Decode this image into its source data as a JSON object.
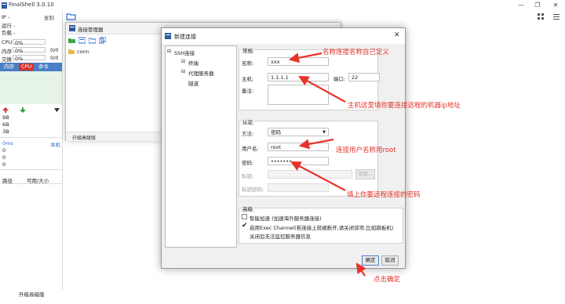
{
  "app": {
    "title": "FinalShell 3.0.10",
    "copy_label": "复制",
    "ip_label": "IP -",
    "uptime_label": "运行 -",
    "load_label": "负载 -",
    "cpu_label": "CPU",
    "cpu_value": "0%",
    "mem_label": "内存",
    "mem_value": "0%",
    "mem_ratio": "0/0",
    "swap_label": "交换",
    "swap_value": "0%",
    "swap_ratio": "0/0",
    "proc_tabs": [
      "内存",
      "CPU",
      "命令"
    ],
    "net_scale": [
      "9B",
      "6B",
      "3B"
    ],
    "latency_label": "0ms",
    "host_label": "本机",
    "latency_values": [
      "0",
      "0",
      "0"
    ],
    "disk_path_label": "路径",
    "disk_size_label": "可用/大小",
    "upgrade_label": "升级高级版"
  },
  "conn_mgr": {
    "title": "连接管理器",
    "items": [
      "conn"
    ],
    "upgrade_label": "升级高级版"
  },
  "dialog": {
    "title": "新建连接",
    "tree": {
      "root": "SSH连接",
      "children": [
        "终端",
        "代理服务器",
        "隧道"
      ]
    },
    "general": {
      "group_label": "常规",
      "name_label": "名称:",
      "name_value": "xxx",
      "host_label": "主机:",
      "host_value": "1.1.1.1",
      "port_label": "端口:",
      "port_value": "22",
      "remark_label": "备注:"
    },
    "auth": {
      "group_label": "认证",
      "method_label": "方法:",
      "method_value": "密码",
      "user_label": "用户名:",
      "user_value": "root",
      "pass_label": "密码:",
      "pass_value": "•••••••",
      "key_label": "私钥:",
      "browse_label": "浏览...",
      "keypass_label": "私钥密码:"
    },
    "advanced": {
      "group_label": "高级",
      "smart_accel": "智能加速 (加速海外服务器连接)",
      "exec_channel": "启用Exec Channel(若连接上就被断开,请关闭该项,比如跳板机)",
      "exec_note": "关闭后无法监控服务器信息"
    },
    "ok_label": "确定",
    "cancel_label": "取消"
  },
  "annotations": {
    "name": "名称连接名称自己定义",
    "host": "主机这里填你要连接远程的机器ip地址",
    "user": "连接用户名称用root",
    "pass": "填上你要远程连接的密码",
    "ok": "点击确定"
  },
  "colors": {
    "accent": "#4a7fc5",
    "annotation": "#e8332a",
    "proc_tab_active": "#d9302a"
  }
}
